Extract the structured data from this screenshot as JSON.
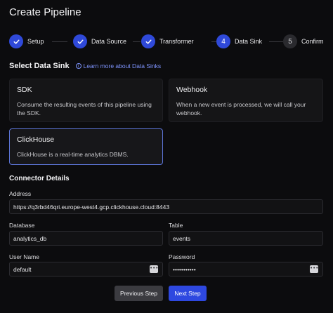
{
  "page": {
    "title": "Create Pipeline"
  },
  "stepper": {
    "steps": [
      {
        "label": "Setup",
        "state": "done",
        "marker": "✓"
      },
      {
        "label": "Data Source",
        "state": "done",
        "marker": "✓"
      },
      {
        "label": "Transformer",
        "state": "done",
        "marker": "✓"
      },
      {
        "label": "Data Sink",
        "state": "current",
        "marker": "4"
      },
      {
        "label": "Confirm",
        "state": "pending",
        "marker": "5"
      }
    ]
  },
  "sink": {
    "heading": "Select Data Sink",
    "learn_more": "Learn more about Data Sinks",
    "options": [
      {
        "title": "SDK",
        "description": "Consume the resulting events of this pipeline using the SDK.",
        "selected": false
      },
      {
        "title": "Webhook",
        "description": "When a new event is processed, we will call your webhook.",
        "selected": false
      },
      {
        "title": "ClickHouse",
        "description": "ClickHouse is a real-time analytics DBMS.",
        "selected": true
      }
    ]
  },
  "connector": {
    "heading": "Connector Details",
    "address": {
      "label": "Address",
      "value": "https://q3rbd46qri.europe-west4.gcp.clickhouse.cloud:8443"
    },
    "database": {
      "label": "Database",
      "value": "analytics_db"
    },
    "table": {
      "label": "Table",
      "value": "events"
    },
    "username": {
      "label": "User Name",
      "value": "default"
    },
    "password": {
      "label": "Password",
      "value": "•••••••••••"
    }
  },
  "actions": {
    "previous": "Previous Step",
    "next": "Next Step"
  },
  "colors": {
    "accent": "#2e48e0",
    "link": "#7f95ff",
    "background": "#0c0c0e",
    "selected_border": "#5c74d6"
  }
}
